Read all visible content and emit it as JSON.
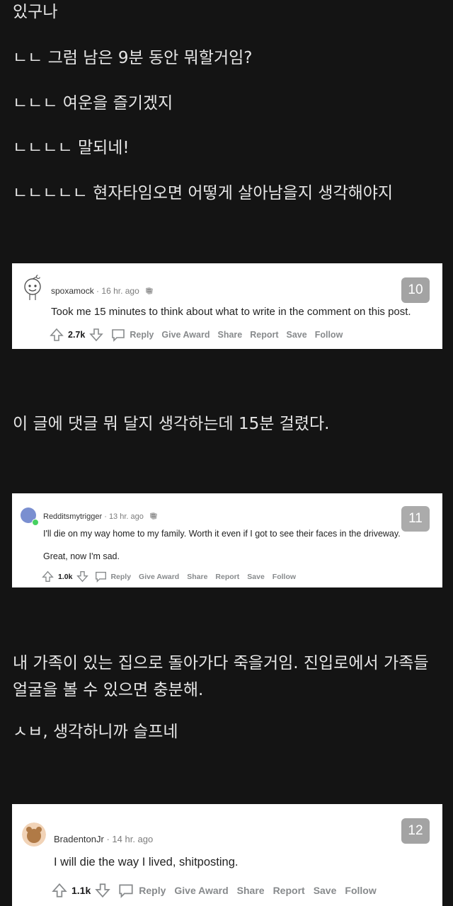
{
  "intro_lines": [
    "있구나",
    "ㄴㄴ 그럼 남은 9분 동안 뭐할거임?",
    "ㄴㄴㄴ 여운을 즐기겠지",
    "ㄴㄴㄴㄴ 말되네!",
    "ㄴㄴㄴㄴㄴ 현자타임오면 어떻게 살아남을지 생각해야지"
  ],
  "comments": [
    {
      "user": "spoxamock",
      "sep": "·",
      "time": "16 hr. ago",
      "body": [
        "Took me 15 minutes to think about what to write in the comment on this post."
      ],
      "score": "2.7k",
      "actions": [
        "Reply",
        "Give Award",
        "Share",
        "Report",
        "Save",
        "Follow"
      ],
      "number": "10",
      "translation": [
        "이 글에 댓글 뭐 달지 생각하는데 15분 걸렸다."
      ]
    },
    {
      "user": "Redditsmytrigger",
      "sep": "·",
      "time": "13 hr. ago",
      "body": [
        "I'll die on my way home to my family. Worth it even if I got to see their faces in the driveway.",
        "Great, now I'm sad."
      ],
      "score": "1.0k",
      "actions": [
        "Reply",
        "Give Award",
        "Share",
        "Report",
        "Save",
        "Follow"
      ],
      "number": "11",
      "translation": [
        "내 가족이 있는 집으로 돌아가다 죽을거임. 진입로에서 가족들 얼굴을 볼 수 있으면 충분해.",
        "ㅅㅂ, 생각하니까 슬프네"
      ]
    },
    {
      "user": "BradentonJr",
      "sep": "·",
      "time": "14 hr. ago",
      "body": [
        "I will die the way I lived, shitposting."
      ],
      "score": "1.1k",
      "actions": [
        "Reply",
        "Give Award",
        "Share",
        "Report",
        "Save",
        "Follow"
      ],
      "number": "12",
      "translation": []
    }
  ],
  "colors": {
    "background": "#141414",
    "card": "#ffffff",
    "badge": "#a3a3a3",
    "online": "#46d160"
  }
}
